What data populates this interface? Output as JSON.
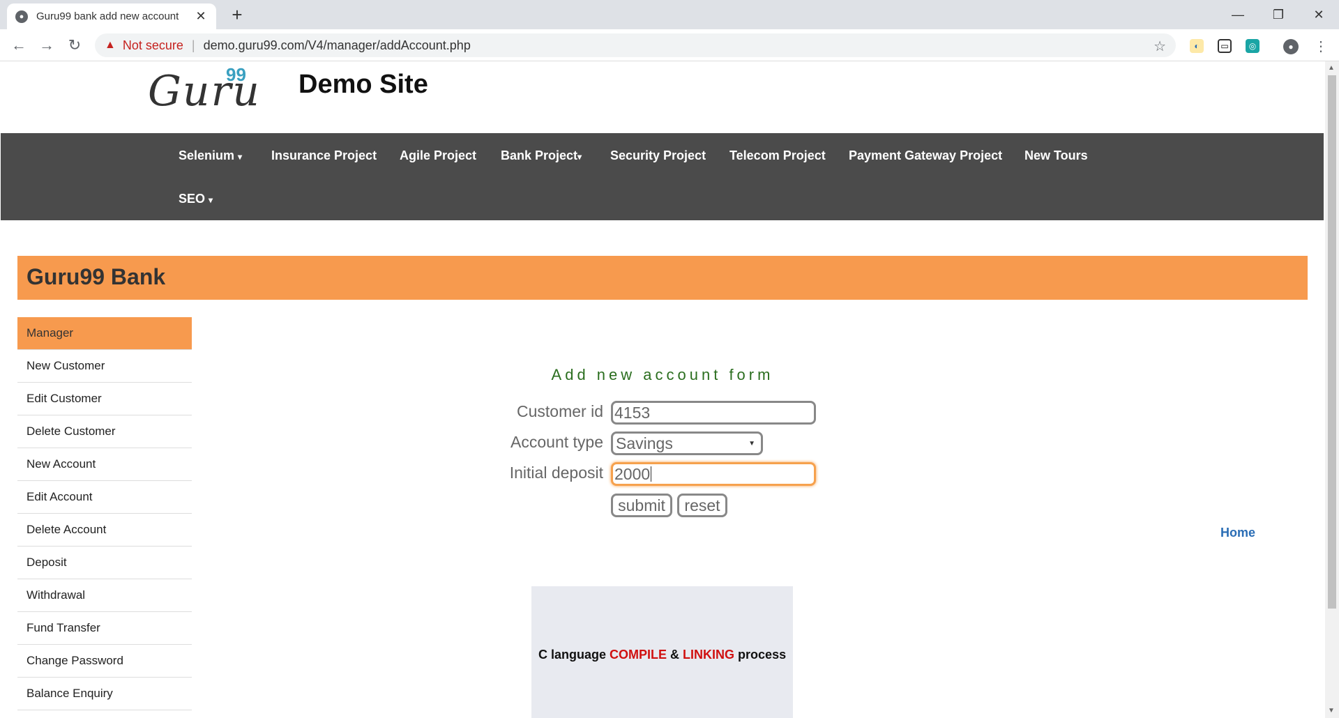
{
  "browser": {
    "tab_title": "Guru99 bank add new account",
    "new_tab_label": "+",
    "not_secure_label": "Not secure",
    "url": "demo.guru99.com/V4/manager/addAccount.php"
  },
  "header": {
    "logo_text": "Guru",
    "logo_sup": "99",
    "site_title": "Demo Site"
  },
  "nav": {
    "items": [
      {
        "label": "Selenium"
      },
      {
        "label": "Insurance Project"
      },
      {
        "label": "Agile Project"
      },
      {
        "label": "Bank Project"
      },
      {
        "label": "Security Project"
      },
      {
        "label": "Telecom Project"
      },
      {
        "label": "Payment Gateway Project"
      },
      {
        "label": "New Tours"
      },
      {
        "label": "SEO"
      }
    ]
  },
  "bank": {
    "title": "Guru99 Bank"
  },
  "sidebar": {
    "items": [
      {
        "label": "Manager"
      },
      {
        "label": "New Customer"
      },
      {
        "label": "Edit Customer"
      },
      {
        "label": "Delete Customer"
      },
      {
        "label": "New Account"
      },
      {
        "label": "Edit Account"
      },
      {
        "label": "Delete Account"
      },
      {
        "label": "Deposit"
      },
      {
        "label": "Withdrawal"
      },
      {
        "label": "Fund Transfer"
      },
      {
        "label": "Change Password"
      },
      {
        "label": "Balance Enquiry"
      }
    ]
  },
  "form": {
    "title": "Add new account form",
    "customer_id_label": "Customer id",
    "customer_id_value": "4153",
    "account_type_label": "Account type",
    "account_type_value": "Savings",
    "initial_deposit_label": "Initial deposit",
    "initial_deposit_value": "2000",
    "submit_label": "submit",
    "reset_label": "reset"
  },
  "home_link": "Home",
  "ad": {
    "part1": "C language ",
    "part2": "COMPILE",
    "part3": " & ",
    "part4": "LINKING",
    "part5": " process"
  },
  "colors": {
    "accent_orange": "#f79a4e",
    "nav_bg": "#4b4b4b",
    "form_title": "#2b6e1f",
    "link_blue": "#2a6db5"
  }
}
